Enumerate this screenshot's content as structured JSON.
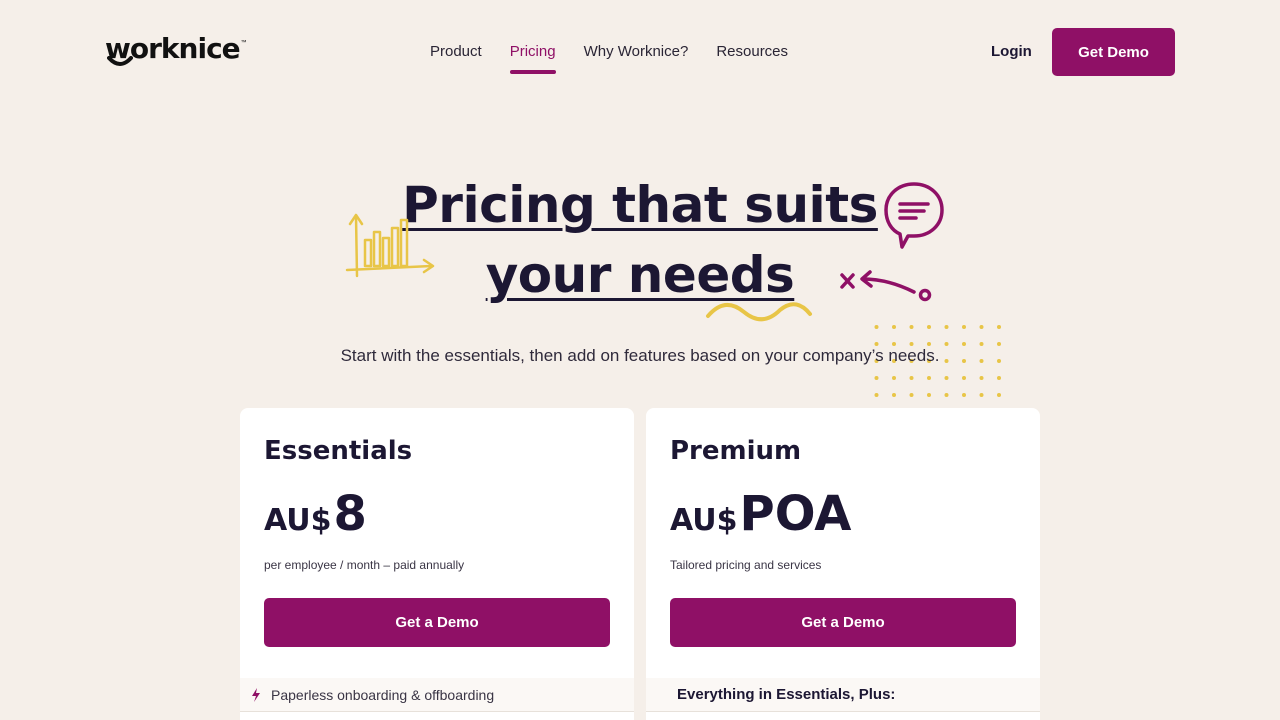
{
  "header": {
    "logo_text": "worknice",
    "logo_tm": "™",
    "nav": [
      {
        "label": "Product",
        "active": false
      },
      {
        "label": "Pricing",
        "active": true
      },
      {
        "label": "Why Worknice?",
        "active": false
      },
      {
        "label": "Resources",
        "active": false
      }
    ],
    "login_label": "Login",
    "demo_label": "Get Demo"
  },
  "hero": {
    "title_line1": "Pricing that suits",
    "title_line2": "your needs",
    "subtitle": "Start with the essentials, then add on features based on your company’s needs."
  },
  "plans": [
    {
      "name": "Essentials",
      "currency": "AU$",
      "price": "8",
      "note": "per employee / month – paid annually",
      "cta": "Get a Demo",
      "first_feature": "Paperless onboarding & offboarding"
    },
    {
      "name": "Premium",
      "currency": "AU$",
      "price": "POA",
      "note": "Tailored pricing and services",
      "cta": "Get a Demo",
      "features_heading": "Everything in Essentials, Plus:"
    }
  ],
  "colors": {
    "background": "#f5efe9",
    "brand": "#8f1066",
    "text": "#1c1733",
    "accent_yellow": "#e8c547"
  },
  "icons": [
    "chart-doodle-icon",
    "chat-bubble-icon",
    "arrow-doodle-icon",
    "squiggle-icon",
    "dot-grid-icon",
    "lightning-icon"
  ]
}
